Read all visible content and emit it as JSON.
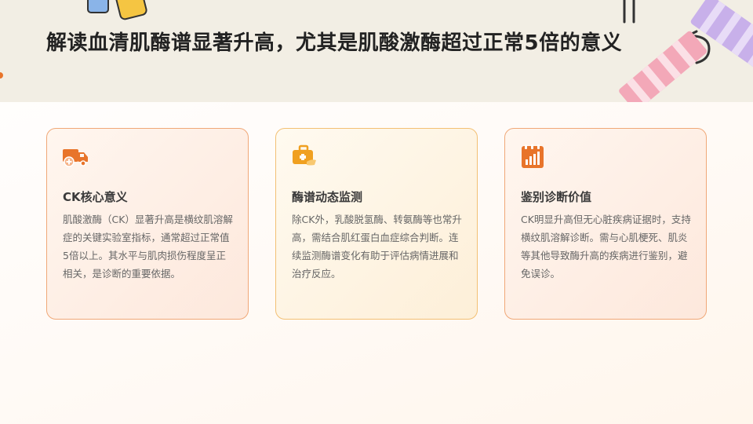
{
  "page": {
    "title": "解读血清肌酶谱显著升高，尤其是肌酸激酶超过正常5倍的意义"
  },
  "colors": {
    "accent": "#e8742a",
    "header_bg": "#f2eee4",
    "card_border_orange": "#f0a878",
    "card_border_amber": "#f3c074"
  },
  "cards": [
    {
      "icon": "ambulance-icon",
      "title": "CK核心意义",
      "body": "肌酸激酶（CK）显著升高是横纹肌溶解症的关键实验室指标，通常超过正常值5倍以上。其水平与肌肉损伤程度呈正相关，是诊断的重要依据。"
    },
    {
      "icon": "medical-kit-icon",
      "title": "酶谱动态监测",
      "body": "除CK外，乳酸脱氢酶、转氨酶等也常升高，需结合肌红蛋白血症综合判断。连续监测酶谱变化有助于评估病情进展和治疗反应。"
    },
    {
      "icon": "calendar-chart-icon",
      "title": "鉴别诊断价值",
      "body": "CK明显升高但无心脏疾病证据时，支持横纹肌溶解诊断。需与心肌梗死、肌炎等其他导致酶升高的疾病进行鉴别，避免误诊。"
    }
  ]
}
